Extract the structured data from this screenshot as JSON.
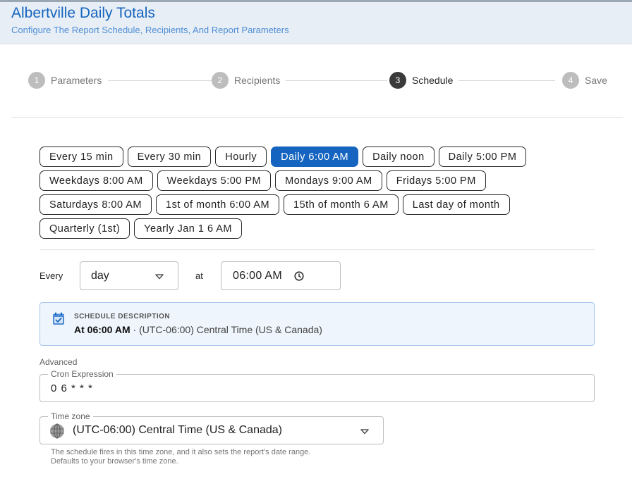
{
  "header": {
    "title": "Albertville Daily Totals",
    "subtitle": "Configure The Report Schedule, Recipients, And Report Parameters"
  },
  "stepper": {
    "steps": [
      {
        "number": "1",
        "label": "Parameters"
      },
      {
        "number": "2",
        "label": "Recipients"
      },
      {
        "number": "3",
        "label": "Schedule"
      },
      {
        "number": "4",
        "label": "Save"
      }
    ],
    "active_step": "3"
  },
  "presets": {
    "rows": [
      [
        "Every 15 min",
        "Every 30 min",
        "Hourly",
        "Daily 6:00 AM",
        "Daily noon",
        "Daily 5:00 PM"
      ],
      [
        "Weekdays 8:00 AM",
        "Weekdays 5:00 PM",
        "Mondays 9:00 AM",
        "Fridays 5:00 PM"
      ],
      [
        "Saturdays 8:00 AM",
        "1st of month 6:00 AM",
        "15th of month 6 AM",
        "Last day of month"
      ],
      [
        "Quarterly (1st)",
        "Yearly Jan 1 6 AM"
      ]
    ],
    "selected": "Daily 6:00 AM"
  },
  "frequency": {
    "every_label": "Every",
    "unit_value": "day",
    "at_label": "at",
    "time_value": "06:00 AM"
  },
  "description": {
    "heading": "SCHEDULE DESCRIPTION",
    "time_bold": "At 06:00 AM",
    "rest": " · (UTC-06:00) Central Time (US & Canada)"
  },
  "advanced": {
    "label": "Advanced",
    "cron_label": "Cron Expression",
    "cron_value": "0 6 * * *"
  },
  "timezone": {
    "label": "Time zone",
    "value": "(UTC-06:00) Central Time (US & Canada)",
    "helper_line1": "The schedule fires in this time zone, and it also sets the report's date range.",
    "helper_line2": "Defaults to your browser's time zone."
  },
  "colors": {
    "accent": "#1565c0",
    "header_bg": "#e8eef5",
    "description_bg": "#eef5fc"
  }
}
